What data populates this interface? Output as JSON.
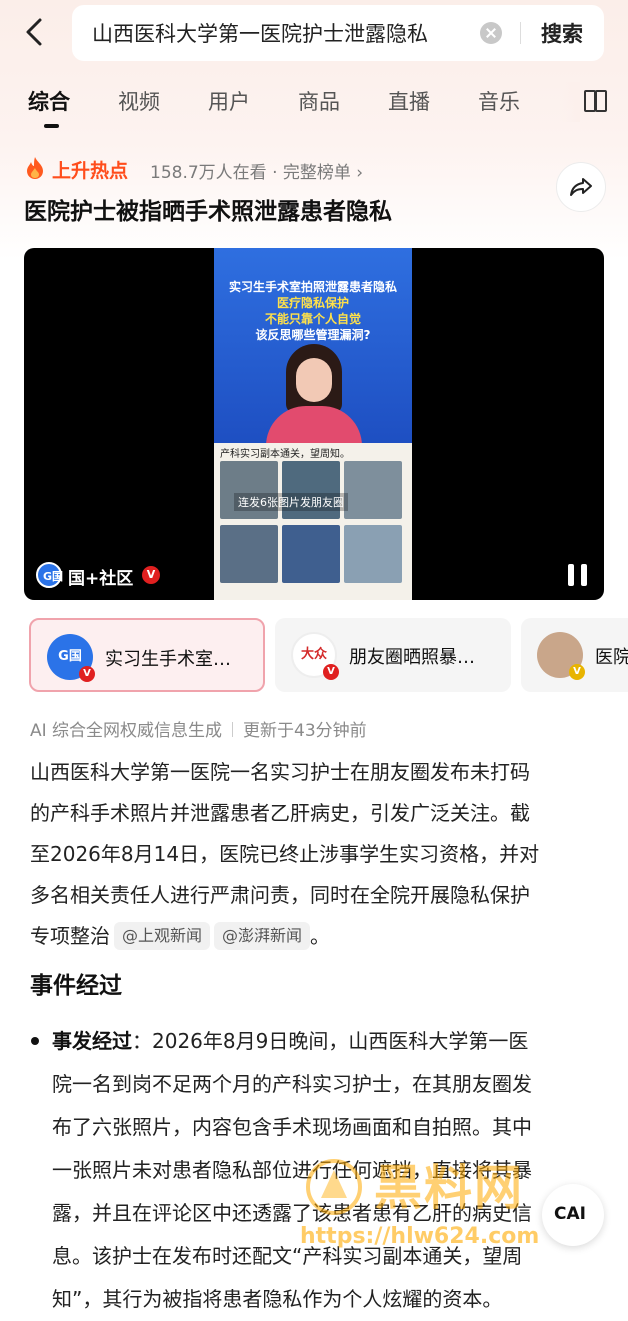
{
  "search": {
    "query": "山西医科大学第一医院护士泄露隐私",
    "button_label": "搜索"
  },
  "tabs": [
    {
      "label": "综合",
      "active": true
    },
    {
      "label": "视频"
    },
    {
      "label": "用户"
    },
    {
      "label": "商品"
    },
    {
      "label": "直播"
    },
    {
      "label": "音乐"
    }
  ],
  "hot": {
    "label": "上升热点",
    "meta": "158.7万人在看 · 完整榜单 ›"
  },
  "headline": "医院护士被指晒手术照泄露患者隐私",
  "video": {
    "lines": [
      "实习生手术室拍照泄露患者隐私",
      "医疗隐私保护",
      "不能只靠个人自觉",
      "该反思哪些管理漏洞?"
    ],
    "photo_caption": "产科实习副本通关，望周知。",
    "photo_note": "连发6张图片发朋友圈",
    "source_name": "国+社区",
    "source_logo_text": "G国",
    "verified_mark": "V"
  },
  "source_cards": [
    {
      "title": "实习生手术室…",
      "logo": "G国",
      "active": true,
      "logo_color": "#2b73e8"
    },
    {
      "title": "朋友圈晒照暴…",
      "logo": "大众",
      "active": false,
      "logo_color": "#d32a2a"
    },
    {
      "title": "医院",
      "logo": "",
      "active": false,
      "logo_color": "#c9a68a"
    }
  ],
  "ai_note": {
    "left": "AI 综合全网权威信息生成",
    "right": "更新于43分钟前"
  },
  "summary": {
    "lines": [
      "山西医科大学第一医院一名实习护士在朋友圈发布未打码",
      "的产科手术照片并泄露患者乙肝病史，引发广泛关注。截",
      "至2026年8月14日，医院已终止涉事学生实习资格，并对",
      "多名相关责任人进行严肃问责，同时在全院开展隐私保护"
    ],
    "last_line": "专项整治",
    "sources": [
      "@上观新闻",
      "@澎湃新闻"
    ],
    "end": "。"
  },
  "section_title": "事件经过",
  "event": {
    "label": "事发经过",
    "lines": [
      "：2026年8月9日晚间，山西医科大学第一医",
      "院一名到岗不足两个月的产科实习护士，在其朋友圈发",
      "布了六张照片，内容包含手术现场画面和自拍照。其中",
      "一张照片未对患者隐私部位进行任何遮挡，直接将其暴",
      "露，并且在评论区中还透露了该患者患有乙肝的病史信",
      "息。该护士在发布时还配文“产科实习副本通关，望周",
      "知”，其行为被指将患者隐私作为个人炫耀的资本。"
    ]
  },
  "watermark": {
    "text": "黑料网",
    "url": "https://hlw624.com"
  },
  "float_button": "CAI"
}
